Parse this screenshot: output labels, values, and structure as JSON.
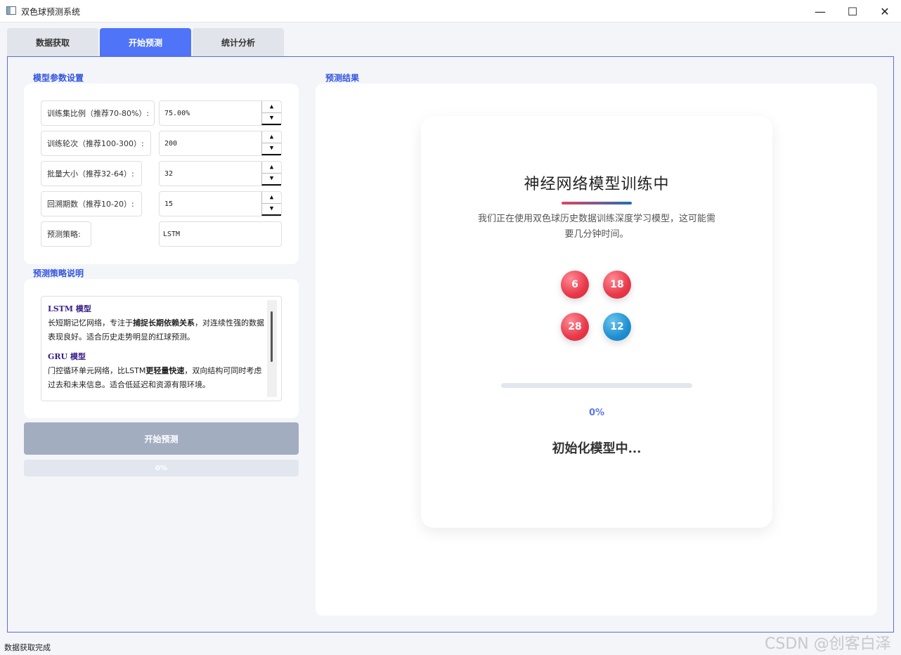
{
  "window": {
    "title": "双色球预测系统"
  },
  "tabs": [
    {
      "label": "数据获取"
    },
    {
      "label": "开始预测"
    },
    {
      "label": "统计分析"
    }
  ],
  "params": {
    "section_label": "模型参数设置",
    "rows": [
      {
        "label": "训练集比例（推荐70-80%）:",
        "value": "75.00%"
      },
      {
        "label": "训练轮次（推荐100-300）:",
        "value": "200"
      },
      {
        "label": "批量大小（推荐32-64）:",
        "value": "32"
      },
      {
        "label": "回溯期数（推荐10-20）:",
        "value": "15"
      },
      {
        "label": "预测策略:",
        "value": "LSTM"
      }
    ]
  },
  "strategy": {
    "section_label": "预测策略说明",
    "lstm_title": "LSTM 模型",
    "lstm_text_1": "长短期记忆网络，专注于",
    "lstm_bold": "捕捉长期依赖关系",
    "lstm_text_2": "，对连续性强的数据表现良好。适合历史走势明显的红球预测。",
    "gru_title": "GRU 模型",
    "gru_text_1": "门控循环单元网络，比LSTM",
    "gru_bold": "更轻量快速",
    "gru_text_2": "，双向结构可同时考虑过去和未来信息。适合低延迟和资源有限环境。"
  },
  "actions": {
    "start_label": "开始预测",
    "progress_label": "0%",
    "progress_value": 0
  },
  "results": {
    "section_label": "预测结果",
    "title": "神经网络模型训练中",
    "description": "我们正在使用双色球历史数据训练深度学习模型，这可能需要几分钟时间。",
    "balls": [
      {
        "number": "6",
        "color": "red"
      },
      {
        "number": "18",
        "color": "red"
      },
      {
        "number": "28",
        "color": "red"
      },
      {
        "number": "12",
        "color": "blue"
      }
    ],
    "progress_value": 0,
    "progress_label": "0%",
    "status": "初始化模型中..."
  },
  "statusbar": {
    "text": "数据获取完成"
  },
  "watermark": {
    "text": "CSDN @创客白泽"
  },
  "colors": {
    "accent": "#4f74f7",
    "red_ball": "#e8384a",
    "blue_ball": "#1f8fd0"
  }
}
